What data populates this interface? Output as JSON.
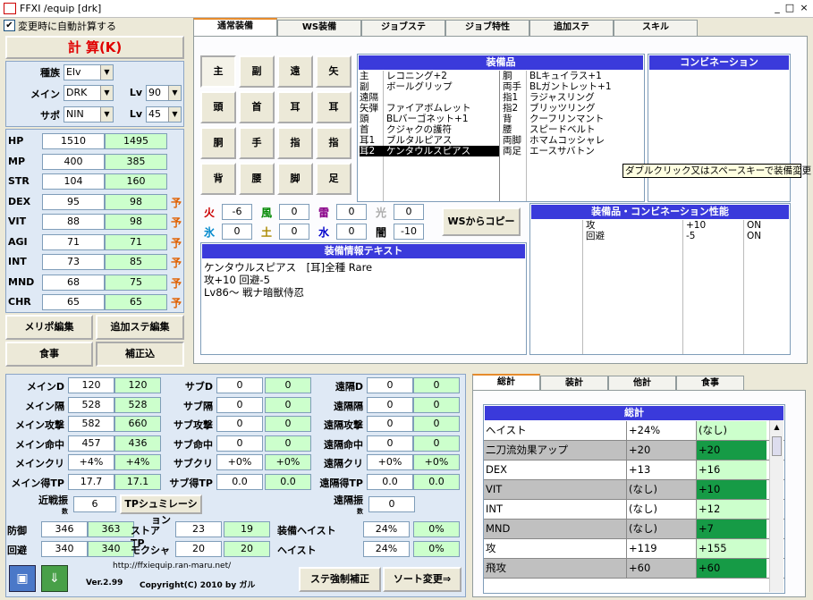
{
  "window": {
    "title": "FFXI /equip [drk]"
  },
  "autocalc": {
    "label": "変更時に自動計算する",
    "checked": true
  },
  "calc_button": "計 算(K)",
  "char": {
    "race_label": "種族",
    "race": "Elv",
    "main_label": "メイン",
    "main": "DRK",
    "sub_label": "サポ",
    "sub": "NIN",
    "lv_label": "Lv",
    "main_lv": "90",
    "sub_lv": "45"
  },
  "stats": [
    {
      "name": "HP",
      "base": "1510",
      "total": "1495",
      "flag": ""
    },
    {
      "name": "MP",
      "base": "400",
      "total": "385",
      "flag": ""
    },
    {
      "name": "STR",
      "base": "104",
      "total": "160",
      "flag": ""
    },
    {
      "name": "DEX",
      "base": "95",
      "total": "98",
      "flag": "予"
    },
    {
      "name": "VIT",
      "base": "88",
      "total": "98",
      "flag": "予"
    },
    {
      "name": "AGI",
      "base": "71",
      "total": "71",
      "flag": "予"
    },
    {
      "name": "INT",
      "base": "73",
      "total": "85",
      "flag": "予"
    },
    {
      "name": "MND",
      "base": "68",
      "total": "75",
      "flag": "予"
    },
    {
      "name": "CHR",
      "base": "65",
      "total": "65",
      "flag": "予"
    }
  ],
  "leftbuttons": {
    "merit": "メリポ編集",
    "addstat": "追加ステ編集",
    "food": "食事",
    "correction": "補正込"
  },
  "tabs": [
    "通常装備",
    "WS装備",
    "ジョブステ",
    "ジョブ特性",
    "追加ステ",
    "スキル"
  ],
  "slots": [
    "主",
    "副",
    "遠",
    "矢",
    "頭",
    "首",
    "耳",
    "耳",
    "胴",
    "手",
    "指",
    "指",
    "背",
    "腰",
    "脚",
    "足"
  ],
  "equip": {
    "header": "装備品",
    "left": [
      [
        "主",
        "レコニング+2"
      ],
      [
        "副",
        "ボールグリップ"
      ],
      [
        "遠隔",
        ""
      ],
      [
        "矢弾",
        "ファイアボムレット"
      ],
      [
        "頭",
        "BLバーゴネット+1"
      ],
      [
        "首",
        "クジャクの護符"
      ],
      [
        "耳1",
        "ブルタルピアス"
      ],
      [
        "耳2",
        "ケンタウルスピアス"
      ]
    ],
    "right": [
      [
        "胴",
        "BLキュイラス+1"
      ],
      [
        "両手",
        "BLガントレット+1"
      ],
      [
        "指1",
        "ラジャスリング"
      ],
      [
        "指2",
        "ブリッツリング"
      ],
      [
        "背",
        "クーフリンマント"
      ],
      [
        "腰",
        "スピードベルト"
      ],
      [
        "両脚",
        "ホマムコッシャレ"
      ],
      [
        "両足",
        "エースサバトン"
      ]
    ]
  },
  "combo": {
    "header": "コンビネーション",
    "tooltip": "ダブルクリック又はスペースキーで装備変更"
  },
  "elements": [
    {
      "name": "火",
      "value": "-6",
      "color": "#cc0000"
    },
    {
      "name": "風",
      "value": "0",
      "color": "#008800"
    },
    {
      "name": "雷",
      "value": "0",
      "color": "#880088"
    },
    {
      "name": "光",
      "value": "0",
      "color": "#aaaaaa"
    },
    {
      "name": "氷",
      "value": "0",
      "color": "#0088cc"
    },
    {
      "name": "土",
      "value": "0",
      "color": "#aa8800"
    },
    {
      "name": "水",
      "value": "0",
      "color": "#0000cc"
    },
    {
      "name": "闇",
      "value": "-10",
      "color": "#000000"
    }
  ],
  "ws_copy": "WSからコピー",
  "equip_text": {
    "header": "装備情報テキスト",
    "lines": [
      "ケンタウルスピアス　[耳]全種 Rare",
      "攻+10 回避-5",
      "Lv86～ 戦ナ暗獣侍忍"
    ]
  },
  "perf": {
    "header": "装備品・コンビネーション性能",
    "rows": [
      [
        "攻",
        "+10",
        "ON"
      ],
      [
        "回避",
        "-5",
        "ON"
      ]
    ]
  },
  "bottom": {
    "rows": [
      [
        "メインD",
        "120",
        "120",
        "サブD",
        "0",
        "0",
        "遠隔D",
        "0",
        "0"
      ],
      [
        "メイン隔",
        "528",
        "528",
        "サブ隔",
        "0",
        "0",
        "遠隔隔",
        "0",
        "0"
      ],
      [
        "メイン攻撃",
        "582",
        "660",
        "サブ攻撃",
        "0",
        "0",
        "遠隔攻撃",
        "0",
        "0"
      ],
      [
        "メイン命中",
        "457",
        "436",
        "サブ命中",
        "0",
        "0",
        "遠隔命中",
        "0",
        "0"
      ],
      [
        "メインクリ",
        "+4%",
        "+4%",
        "サブクリ",
        "+0%",
        "+0%",
        "遠隔クリ",
        "+0%",
        "+0%"
      ],
      [
        "メイン得TP",
        "17.7",
        "17.1",
        "サブ得TP",
        "0.0",
        "0.0",
        "遠隔得TP",
        "0.0",
        "0.0"
      ]
    ],
    "kinsen_label": "近戦振",
    "kinsen_sub": "数",
    "kinsen": "6",
    "tp_sim": "TPシュミレーション",
    "enkaku_label": "遠隔振",
    "enkaku_sub": "数",
    "enkaku": "0",
    "bottom_rows": [
      [
        "防御",
        "346",
        "363",
        "ストアTP",
        "23",
        "19",
        "装備ヘイスト",
        "24%",
        "0%"
      ],
      [
        "回避",
        "340",
        "340",
        "モクシャ",
        "20",
        "20",
        "ヘイスト",
        "24%",
        "0%"
      ]
    ],
    "url": "http://ffxiequip.ran-maru.net/",
    "version": "Ver.2.99",
    "copyright": "Copyright(C) 2010 by ガル",
    "force_btn": "ステ強制補正",
    "sort_btn": "ソート変更⇒"
  },
  "right_tabs": [
    "総計",
    "装計",
    "他計",
    "食事"
  ],
  "summary": {
    "header": "総計",
    "rows": [
      [
        "ヘイスト",
        "+24%",
        "(なし)"
      ],
      [
        "二刀流効果アップ",
        "+20",
        "+20"
      ],
      [
        "DEX",
        "+13",
        "+16"
      ],
      [
        "VIT",
        "(なし)",
        "+10"
      ],
      [
        "INT",
        "(なし)",
        "+12"
      ],
      [
        "MND",
        "(なし)",
        "+7"
      ],
      [
        "攻",
        "+119",
        "+155"
      ],
      [
        "飛攻",
        "+60",
        "+60"
      ]
    ]
  }
}
